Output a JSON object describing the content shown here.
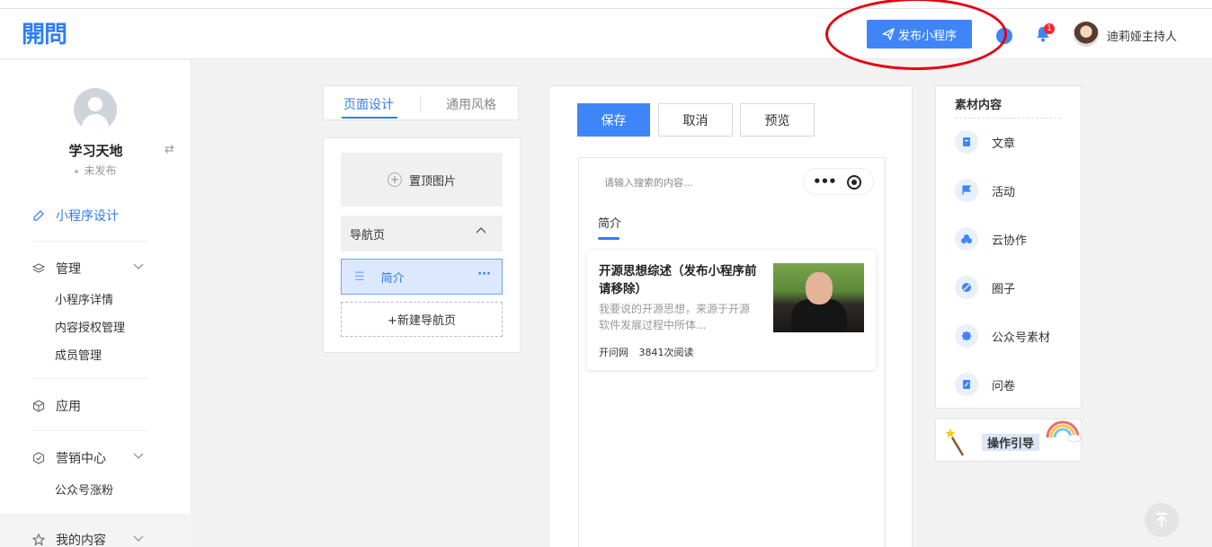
{
  "header": {
    "logo": "開問",
    "publish_label": "发布小程序",
    "notification_count": "1",
    "user_name": "迪莉娅主持人"
  },
  "sidebar": {
    "app_name": "学习天地",
    "status": "未发布",
    "design_label": "小程序设计",
    "manage_label": "管理",
    "manage_items": [
      "小程序详情",
      "内容授权管理",
      "成员管理"
    ],
    "apps_label": "应用",
    "marketing_label": "营销中心",
    "marketing_items": [
      "公众号涨粉"
    ],
    "my_content_label": "我的内容"
  },
  "editor_tabs": {
    "page_design": "页面设计",
    "general_style": "通用风格"
  },
  "page_panel": {
    "cover_label": "置顶图片",
    "nav_header": "导航页",
    "nav_items": [
      "简介"
    ],
    "new_nav_label": "+新建导航页"
  },
  "actions": {
    "save": "保存",
    "cancel": "取消",
    "preview": "预览"
  },
  "preview": {
    "search_placeholder": "请输入搜索的内容...",
    "tab_label": "简介",
    "article": {
      "title": "开源思想综述（发布小程序前请移除）",
      "excerpt": "我要说的开源思想，来源于开源软件发展过程中所体...",
      "source": "开问网",
      "reads": "3841次阅读"
    }
  },
  "materials": {
    "title": "素材内容",
    "items": [
      {
        "label": "文章",
        "icon": "article-icon"
      },
      {
        "label": "活动",
        "icon": "flag-icon"
      },
      {
        "label": "云协作",
        "icon": "cloud-collab-icon"
      },
      {
        "label": "圈子",
        "icon": "circle-icon"
      },
      {
        "label": "公众号素材",
        "icon": "wechat-material-icon"
      },
      {
        "label": "问卷",
        "icon": "survey-icon"
      }
    ]
  },
  "guide": {
    "label": "操作引导"
  },
  "colors": {
    "primary": "#3e86f8",
    "annotation_red": "#e60012"
  }
}
